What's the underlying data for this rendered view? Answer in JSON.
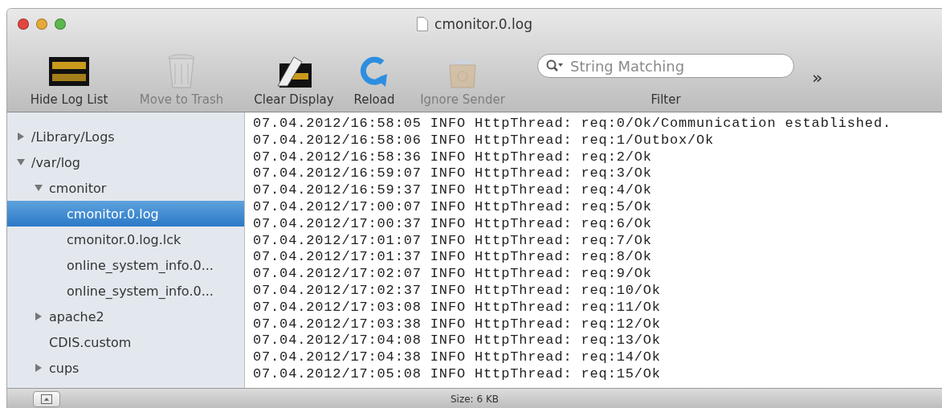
{
  "window": {
    "title": "cmonitor.0.log"
  },
  "toolbar": {
    "items": [
      {
        "kind": "marquee",
        "label": "Hide Log List",
        "disabled": false
      },
      {
        "kind": "trash",
        "label": "Move to Trash",
        "disabled": true
      },
      {
        "kind": "clear",
        "label": "Clear Display",
        "disabled": false
      },
      {
        "kind": "reload",
        "label": "Reload",
        "disabled": false
      },
      {
        "kind": "ignore",
        "label": "Ignore Sender",
        "disabled": true
      }
    ],
    "filter": {
      "placeholder": "String Matching",
      "label": "Filter"
    },
    "overflow": "»"
  },
  "sidebar": {
    "items": [
      {
        "label": "/Library/Logs",
        "expanded": false,
        "selected": false
      },
      {
        "label": "/var/log",
        "expanded": true,
        "selected": false,
        "children": [
          {
            "label": "cmonitor",
            "expanded": true,
            "selected": false,
            "children": [
              {
                "label": "cmonitor.0.log",
                "selected": true
              },
              {
                "label": "cmonitor.0.log.lck",
                "selected": false
              },
              {
                "label": "online_system_info.0...",
                "selected": false
              },
              {
                "label": "online_system_info.0...",
                "selected": false
              }
            ]
          },
          {
            "label": "apache2",
            "expanded": false,
            "selected": false
          },
          {
            "label": "CDIS.custom",
            "selected": false
          },
          {
            "label": "cups",
            "expanded": false,
            "selected": false
          }
        ]
      }
    ]
  },
  "log_lines": [
    "07.04.2012/16:58:05 INFO HttpThread: req:0/Ok/Communication established.",
    "07.04.2012/16:58:06 INFO HttpThread: req:1/Outbox/Ok",
    "07.04.2012/16:58:36 INFO HttpThread: req:2/Ok",
    "07.04.2012/16:59:07 INFO HttpThread: req:3/Ok",
    "07.04.2012/16:59:37 INFO HttpThread: req:4/Ok",
    "07.04.2012/17:00:07 INFO HttpThread: req:5/Ok",
    "07.04.2012/17:00:37 INFO HttpThread: req:6/Ok",
    "07.04.2012/17:01:07 INFO HttpThread: req:7/Ok",
    "07.04.2012/17:01:37 INFO HttpThread: req:8/Ok",
    "07.04.2012/17:02:07 INFO HttpThread: req:9/Ok",
    "07.04.2012/17:02:37 INFO HttpThread: req:10/Ok",
    "07.04.2012/17:03:08 INFO HttpThread: req:11/Ok",
    "07.04.2012/17:03:38 INFO HttpThread: req:12/Ok",
    "07.04.2012/17:04:08 INFO HttpThread: req:13/Ok",
    "07.04.2012/17:04:38 INFO HttpThread: req:14/Ok",
    "07.04.2012/17:05:08 INFO HttpThread: req:15/Ok"
  ],
  "status_bar": {
    "size": "Size: 6 KB"
  }
}
